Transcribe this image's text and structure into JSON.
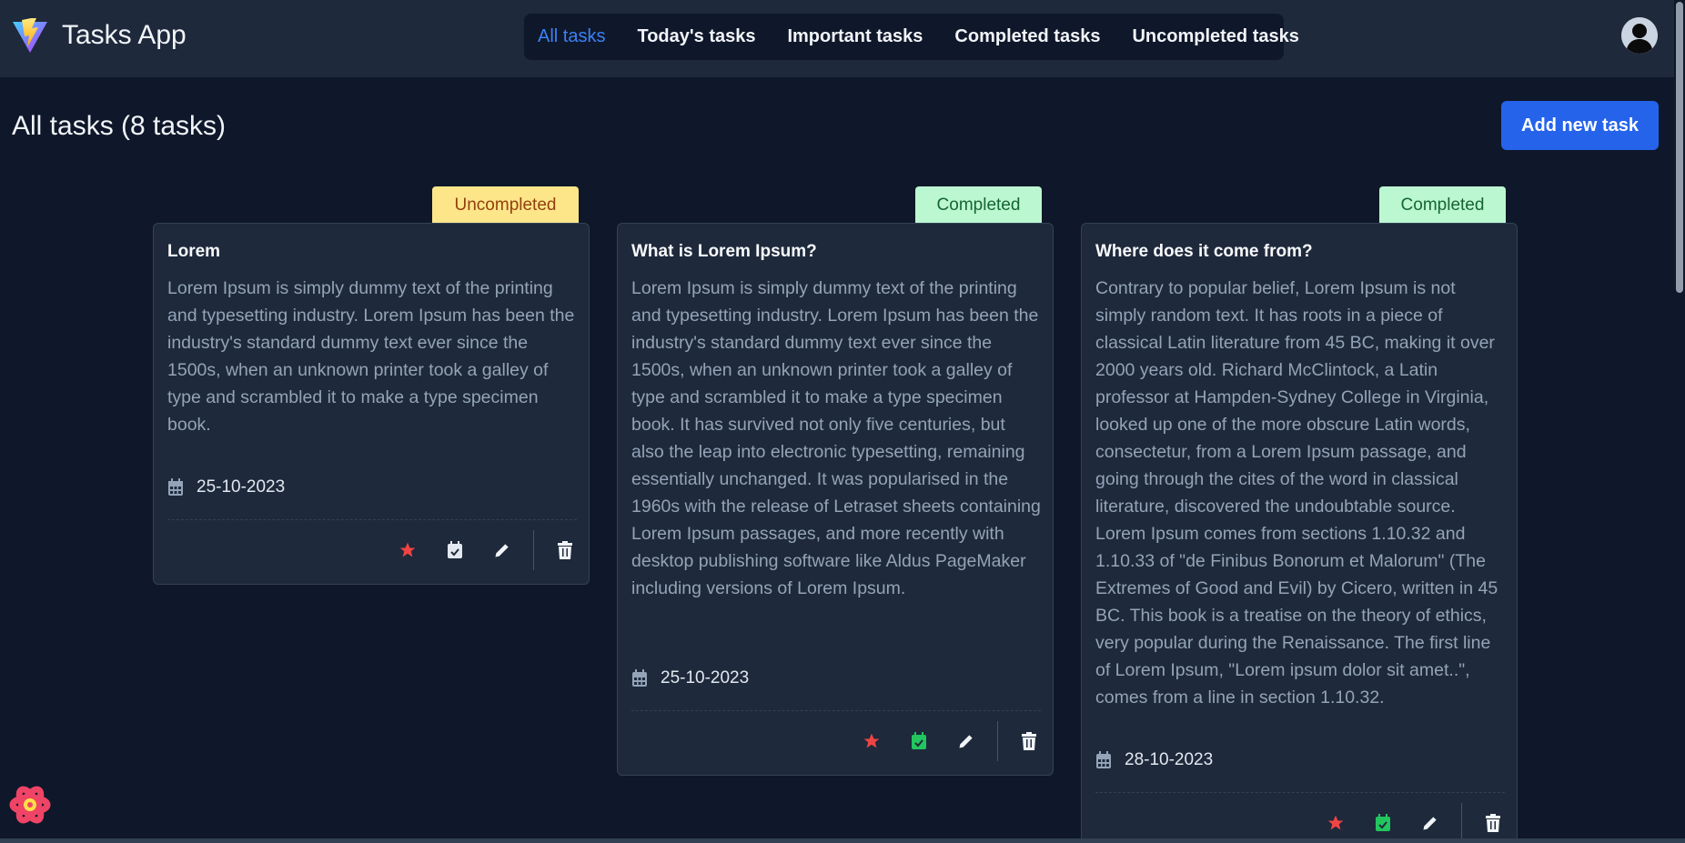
{
  "app": {
    "title": "Tasks App"
  },
  "nav": {
    "items": [
      {
        "label": "All tasks",
        "active": true
      },
      {
        "label": "Today's tasks",
        "active": false
      },
      {
        "label": "Important tasks",
        "active": false
      },
      {
        "label": "Completed tasks",
        "active": false
      },
      {
        "label": "Uncompleted tasks",
        "active": false
      }
    ]
  },
  "page": {
    "title": "All tasks (8 tasks)",
    "add_button": "Add new task"
  },
  "colors": {
    "accent": "#2563eb",
    "nav_active": "#3b82f6",
    "important": "#ef4444",
    "completed_icon": "#22c55e"
  },
  "cards": [
    {
      "status": "Uncompleted",
      "title": "Lorem",
      "description": "Lorem Ipsum is simply dummy text of the printing and typesetting industry. Lorem Ipsum has been the industry's standard dummy text ever since the 1500s, when an unknown printer took a galley of type and scrambled it to make a type specimen book.",
      "date": "25-10-2023",
      "important": true,
      "completed": false
    },
    {
      "status": "Completed",
      "title": "What is Lorem Ipsum?",
      "description": "Lorem Ipsum is simply dummy text of the printing and typesetting industry. Lorem Ipsum has been the industry's standard dummy text ever since the 1500s, when an unknown printer took a galley of type and scrambled it to make a type specimen book. It has survived not only five centuries, but also the leap into electronic typesetting, remaining essentially unchanged. It was popularised in the 1960s with the release of Letraset sheets containing Lorem Ipsum passages, and more recently with desktop publishing software like Aldus PageMaker including versions of Lorem Ipsum.",
      "date": "25-10-2023",
      "important": true,
      "completed": true
    },
    {
      "status": "Completed",
      "title": "Where does it come from?",
      "description": "Contrary to popular belief, Lorem Ipsum is not simply random text. It has roots in a piece of classical Latin literature from 45 BC, making it over 2000 years old. Richard McClintock, a Latin professor at Hampden-Sydney College in Virginia, looked up one of the more obscure Latin words, consectetur, from a Lorem Ipsum passage, and going through the cites of the word in classical literature, discovered the undoubtable source. Lorem Ipsum comes from sections 1.10.32 and 1.10.33 of \"de Finibus Bonorum et Malorum\" (The Extremes of Good and Evil) by Cicero, written in 45 BC. This book is a treatise on the theory of ethics, very popular during the Renaissance. The first line of Lorem Ipsum, \"Lorem ipsum dolor sit amet..\", comes from a line in section 1.10.32.",
      "date": "28-10-2023",
      "important": true,
      "completed": true
    }
  ]
}
